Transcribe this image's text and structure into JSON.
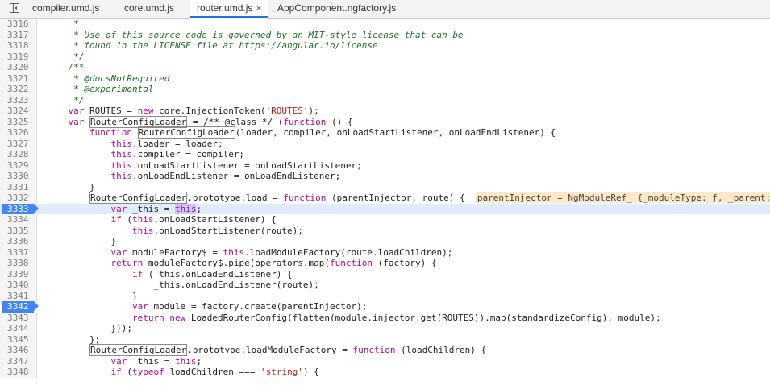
{
  "tabs": [
    {
      "label": "compiler.umd.js",
      "active": false
    },
    {
      "label": "core.umd.js",
      "active": false
    },
    {
      "label": "router.umd.js",
      "active": true,
      "close": "×"
    },
    {
      "label": "AppComponent.ngfactory.js",
      "active": false
    }
  ],
  "editor": {
    "paused_line": 3333,
    "breakpoint_lines": [
      3333,
      3342
    ],
    "inline_value": "parentInjector = NgModuleRef_ {_moduleType: ƒ, _parent: St",
    "lines": [
      {
        "n": "3316",
        "t": "     *"
      },
      {
        "n": "3317",
        "t": "     * Use of this source code is governed by an MIT-style license that can be"
      },
      {
        "n": "3318",
        "t": "     * found in the LICENSE file at https://angular.io/license"
      },
      {
        "n": "3319",
        "t": "     */"
      },
      {
        "n": "3320",
        "t": "    /**"
      },
      {
        "n": "3321",
        "t": "     * @docsNotRequired"
      },
      {
        "n": "3322",
        "t": "     * @experimental"
      },
      {
        "n": "3323",
        "t": "     */"
      },
      {
        "n": "3324",
        "t": "    var ROUTES = new core.InjectionToken('ROUTES');"
      },
      {
        "n": "3325",
        "t": "    var RouterConfigLoader = /** @class */ (function () {"
      },
      {
        "n": "3326",
        "t": "        function RouterConfigLoader(loader, compiler, onLoadStartListener, onLoadEndListener) {"
      },
      {
        "n": "3327",
        "t": "            this.loader = loader;"
      },
      {
        "n": "3328",
        "t": "            this.compiler = compiler;"
      },
      {
        "n": "3329",
        "t": "            this.onLoadStartListener = onLoadStartListener;"
      },
      {
        "n": "3330",
        "t": "            this.onLoadEndListener = onLoadEndListener;"
      },
      {
        "n": "3331",
        "t": "        }"
      },
      {
        "n": "3332",
        "t": "        RouterConfigLoader.prototype.load = function (parentInjector, route) {"
      },
      {
        "n": "3333",
        "t": "            var _this = this;"
      },
      {
        "n": "3334",
        "t": "            if (this.onLoadStartListener) {"
      },
      {
        "n": "3335",
        "t": "                this.onLoadStartListener(route);"
      },
      {
        "n": "3336",
        "t": "            }"
      },
      {
        "n": "3337",
        "t": "            var moduleFactory$ = this.loadModuleFactory(route.loadChildren);"
      },
      {
        "n": "3338",
        "t": "            return moduleFactory$.pipe(operators.map(function (factory) {"
      },
      {
        "n": "3339",
        "t": "                if (_this.onLoadEndListener) {"
      },
      {
        "n": "3340",
        "t": "                    _this.onLoadEndListener(route);"
      },
      {
        "n": "3341",
        "t": "                }"
      },
      {
        "n": "3342",
        "t": "                var module = factory.create(parentInjector);"
      },
      {
        "n": "3343",
        "t": "                return new LoadedRouterConfig(flatten(module.injector.get(ROUTES)).map(standardizeConfig), module);"
      },
      {
        "n": "3344",
        "t": "            }));"
      },
      {
        "n": "3345",
        "t": "        };"
      },
      {
        "n": "3346",
        "t": "        RouterConfigLoader.prototype.loadModuleFactory = function (loadChildren) {"
      },
      {
        "n": "3347",
        "t": "            var _this = this;"
      },
      {
        "n": "3348",
        "t": "            if (typeof loadChildren === 'string') {"
      }
    ]
  },
  "colors": {
    "comment": "#236e25",
    "keyword": "#aa0d91",
    "string": "#c41a16",
    "paused_bg": "#e0ebfb",
    "breakpoint": "#4285f4",
    "tab_accent": "#1a73e8"
  }
}
